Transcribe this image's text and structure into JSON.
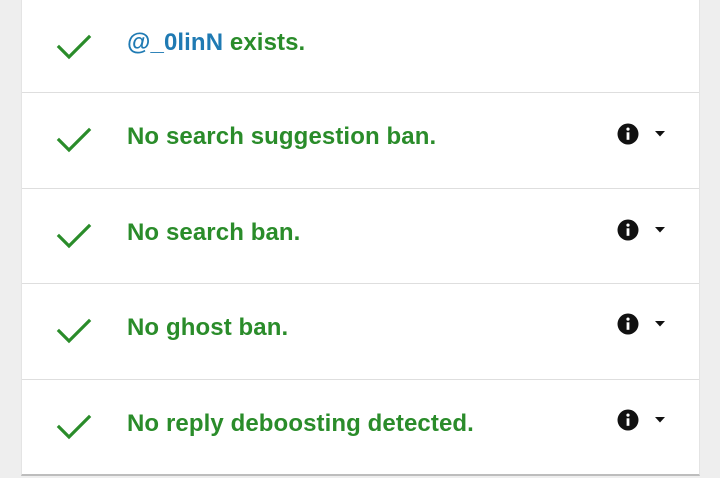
{
  "colors": {
    "success": "#2a8c2a",
    "username": "#1f7ab3",
    "icon": "#111111"
  },
  "rows": [
    {
      "user": "@_0linN",
      "text": " exists.",
      "status_icon": "check-icon",
      "has_actions": false
    },
    {
      "user": "",
      "text": "No search suggestion ban.",
      "status_icon": "check-icon",
      "has_actions": true,
      "action_icons": [
        "info-icon",
        "caret-down-icon"
      ]
    },
    {
      "user": "",
      "text": "No search ban.",
      "status_icon": "check-icon",
      "has_actions": true,
      "action_icons": [
        "info-icon",
        "caret-down-icon"
      ]
    },
    {
      "user": "",
      "text": "No ghost ban.",
      "status_icon": "check-icon",
      "has_actions": true,
      "action_icons": [
        "info-icon",
        "caret-down-icon"
      ]
    },
    {
      "user": "",
      "text": "No reply deboosting detected.",
      "status_icon": "check-icon",
      "has_actions": true,
      "action_icons": [
        "info-icon",
        "caret-down-icon"
      ]
    }
  ]
}
